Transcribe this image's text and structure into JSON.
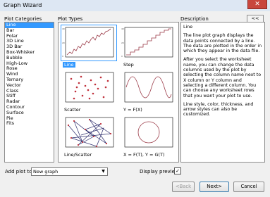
{
  "window": {
    "title": "Graph Wizard",
    "close_label": "✕"
  },
  "plot_categories": {
    "label": "Plot Categories",
    "items": [
      "Line",
      "Bar",
      "Polar",
      "3D Line",
      "3D Bar",
      "Box-Whisker",
      "Bubble",
      "High-Low",
      "Rose",
      "Wind",
      "Ternary",
      "Vector",
      "Class",
      "Stiff",
      "Radar",
      "Contour",
      "Surface",
      "Pie",
      "Fits"
    ],
    "selected": "Line"
  },
  "plot_types": {
    "label": "Plot Types",
    "items": [
      "Line",
      "Step",
      "Scatter",
      "Y = F(X)",
      "Line/Scatter",
      "X = F(T), Y = G(T)"
    ],
    "selected": "Line"
  },
  "description": {
    "label": "Description",
    "collapse_label": "<<",
    "paragraphs": [
      "Line",
      "The line plot graph displays the data points connected by a line.  The data are plotted in the order in which they appear in the data file.",
      "After you select the worksheet name, you can change the data columns used by the plot by selecting the column name next to X column or Y column and selecting a different column.  You can choose any worksheet rows that you want your plot to use.",
      "Line style, color, thickness, and arrow styles can also be customized."
    ]
  },
  "add_plot": {
    "label": "Add plot to:",
    "value": "New graph"
  },
  "preview": {
    "label": "Display preview",
    "checked": "✓"
  },
  "buttons": {
    "back": "<Back",
    "next": "Next>",
    "cancel": "Cancel"
  },
  "colors": {
    "selection": "#3399ff",
    "plot_line": "#9b3b48",
    "plot_marker": "#c0303b",
    "plot_dark": "#2b2b6b",
    "close": "#c8463d"
  }
}
